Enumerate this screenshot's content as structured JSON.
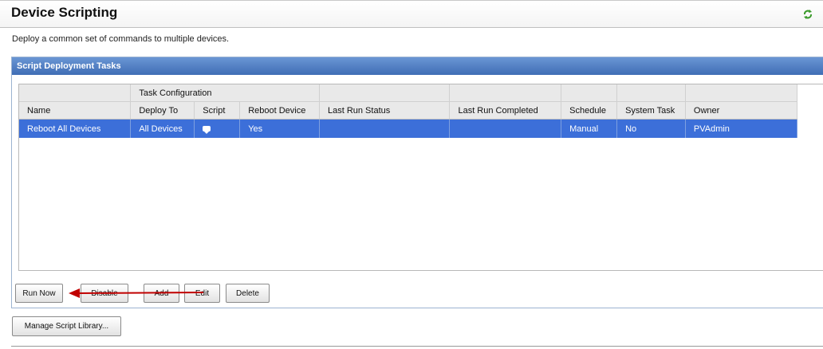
{
  "page": {
    "title": "Device Scripting",
    "subtitle": "Deploy a common set of commands to multiple devices."
  },
  "panel": {
    "title": "Script Deployment Tasks"
  },
  "grid": {
    "group_header": "Task Configuration",
    "columns": {
      "name": "Name",
      "deploy_to": "Deploy To",
      "script": "Script",
      "reboot_device": "Reboot Device",
      "last_run_status": "Last Run Status",
      "last_run_completed": "Last Run Completed",
      "schedule": "Schedule",
      "system_task": "System Task",
      "owner": "Owner"
    },
    "rows": [
      {
        "name": "Reboot All Devices",
        "deploy_to": "All Devices",
        "script_icon": "comment-icon",
        "reboot_device": "Yes",
        "last_run_status": "",
        "last_run_completed": "",
        "schedule": "Manual",
        "system_task": "No",
        "owner": "PVAdmin"
      }
    ]
  },
  "buttons": {
    "run_now": "Run Now",
    "disable": "Disable",
    "add": "Add",
    "edit": "Edit",
    "delete": "Delete",
    "manage_library": "Manage Script Library..."
  },
  "icons": {
    "refresh": "refresh-icon",
    "script": "comment-icon"
  },
  "colors": {
    "selection": "#3c6fd9",
    "panel_header": "#4a78bf",
    "annotation_arrow": "#c00000"
  }
}
